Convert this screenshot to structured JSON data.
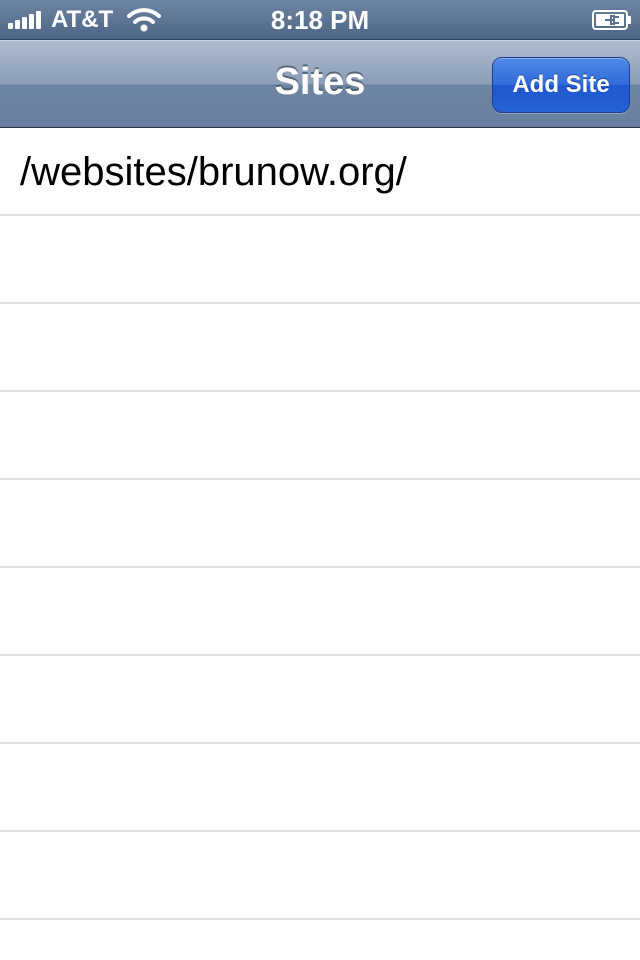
{
  "status_bar": {
    "carrier": "AT&T",
    "time": "8:18 PM",
    "signal_icon": "signal-bars-icon",
    "wifi_icon": "wifi-icon",
    "battery_icon": "battery-charging-icon"
  },
  "nav": {
    "title": "Sites",
    "add_button_label": "Add Site"
  },
  "sites": [
    "/websites/brunow.org/"
  ],
  "colors": {
    "status_bar": "#5a7192",
    "nav_bar": "#8a9db6",
    "add_button": "#2f6ad9",
    "separator": "#e0e0e0"
  }
}
